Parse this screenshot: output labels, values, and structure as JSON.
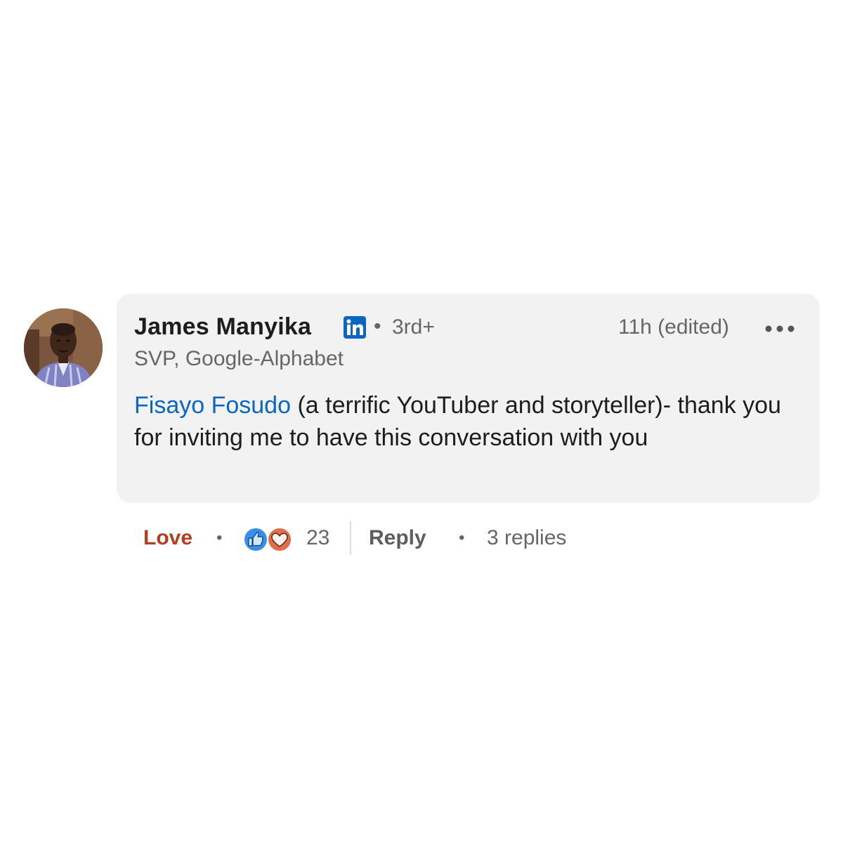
{
  "comment": {
    "author": {
      "name": "James Manyika",
      "badge_icon": "linkedin-icon",
      "badge_text": "in",
      "degree_separator": "•",
      "degree": "3rd+",
      "headline": "SVP, Google-Alphabet",
      "avatar_icon": "profile-photo"
    },
    "timestamp": "11h (edited)",
    "more_icon": "more-options-icon",
    "body": {
      "mention": "Fisayo Fosudo",
      "text": " (a terrific YouTuber and storyteller)- thank you for inviting me to have this conversation with you"
    }
  },
  "actions": {
    "love_label": "Love",
    "separator": "•",
    "reaction_icons": [
      "like-icon",
      "love-icon"
    ],
    "reaction_count": "23",
    "reply_label": "Reply",
    "replies_label": "3 replies"
  },
  "colors": {
    "linkedin_blue": "#0a66c2",
    "love_red": "#b24020",
    "bubble_bg": "#f2f2f2",
    "muted_text": "#666666"
  }
}
